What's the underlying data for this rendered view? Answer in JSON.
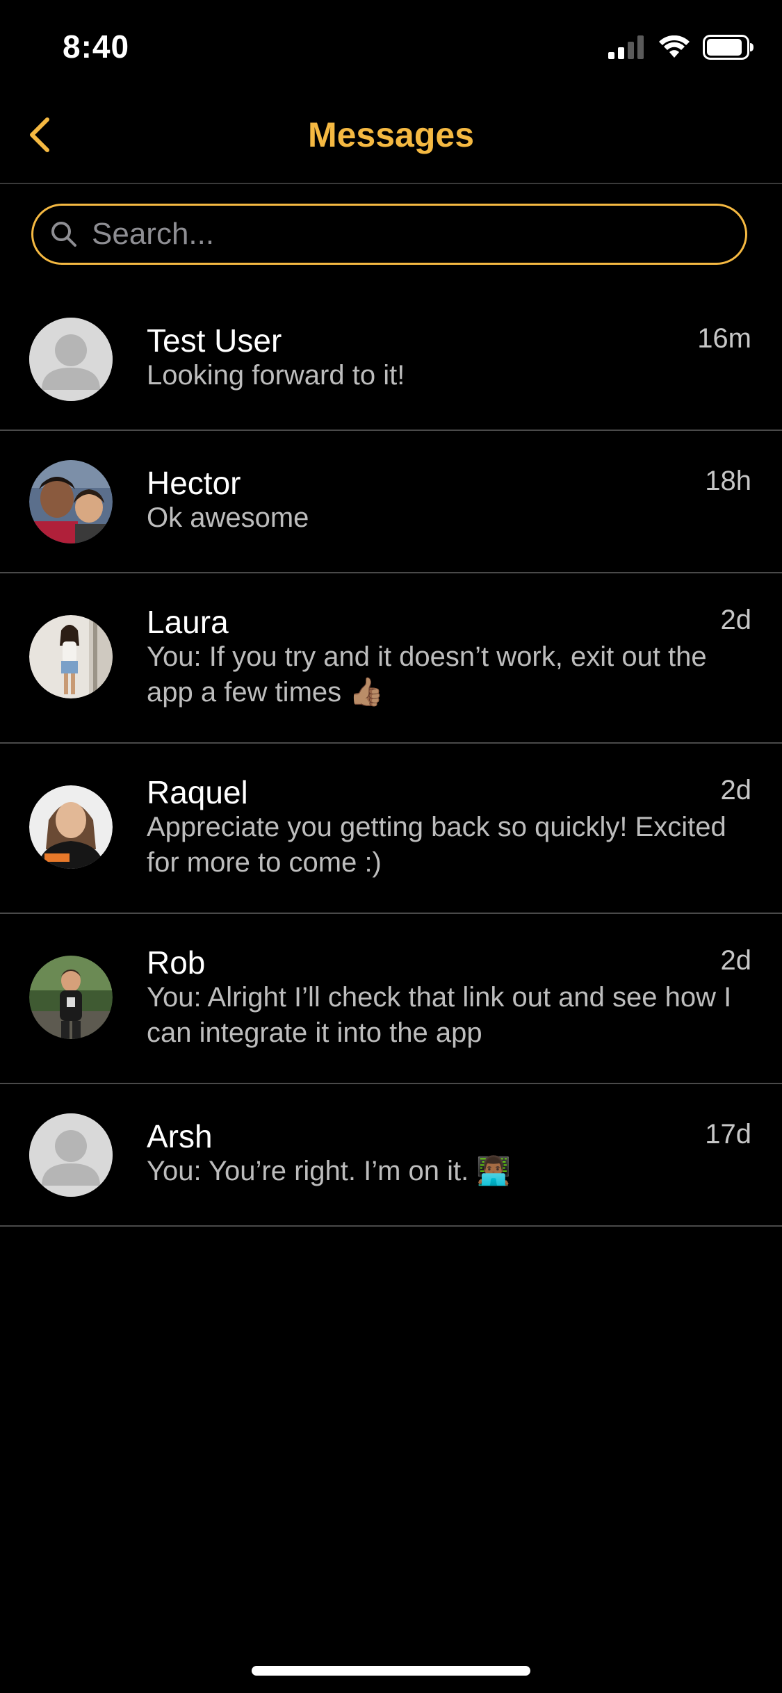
{
  "status_bar": {
    "time": "8:40",
    "icons": [
      "signal-icon",
      "wifi-icon",
      "battery-icon"
    ]
  },
  "nav": {
    "title": "Messages",
    "back_icon": "chevron-left-icon"
  },
  "search": {
    "placeholder": "Search...",
    "value": ""
  },
  "conversations": [
    {
      "name": "Test User",
      "preview": "Looking forward to it!",
      "time": "16m",
      "avatar": "default"
    },
    {
      "name": "Hector",
      "preview": "Ok awesome",
      "time": "18h",
      "avatar": "photo"
    },
    {
      "name": "Laura",
      "preview": "You: If you try and it doesn’t work, exit out the app a few times 👍🏽",
      "time": "2d",
      "avatar": "photo"
    },
    {
      "name": "Raquel",
      "preview": "Appreciate you getting back so quickly! Excited for more to come :)",
      "time": "2d",
      "avatar": "photo"
    },
    {
      "name": "Rob",
      "preview": "You: Alright I’ll check that link out and see how I can integrate it into the app",
      "time": "2d",
      "avatar": "photo"
    },
    {
      "name": "Arsh",
      "preview": "You: You’re right. I’m on it. 👨🏾‍💻",
      "time": "17d",
      "avatar": "default"
    }
  ],
  "colors": {
    "accent": "#f5b942",
    "background": "#000000",
    "divider": "#4a4a4a",
    "secondary_text": "#bdbdbd"
  }
}
